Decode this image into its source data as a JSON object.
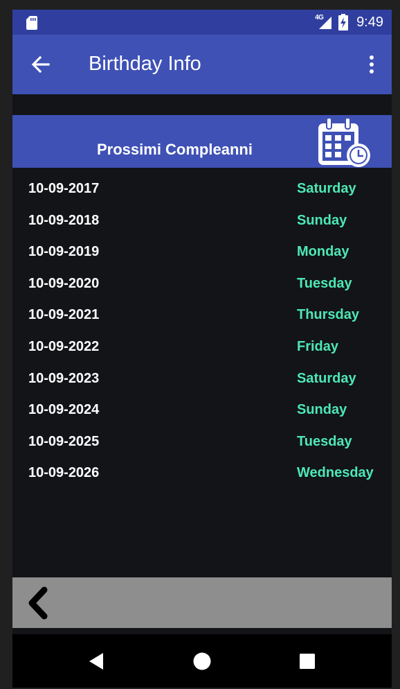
{
  "status_bar": {
    "network": "4G",
    "time": "9:49",
    "icons": [
      "sd-card-icon",
      "signal-icon",
      "battery-charging-icon"
    ]
  },
  "app_bar": {
    "title": "Birthday Info",
    "icons": [
      "back-arrow-icon",
      "more-vert-icon"
    ]
  },
  "header": {
    "title": "Prossimi Compleanni",
    "icon": "calendar-clock-icon"
  },
  "birthdays": [
    {
      "date": "10-09-2017",
      "day": "Saturday"
    },
    {
      "date": "10-09-2018",
      "day": "Sunday"
    },
    {
      "date": "10-09-2019",
      "day": "Monday"
    },
    {
      "date": "10-09-2020",
      "day": "Tuesday"
    },
    {
      "date": "10-09-2021",
      "day": "Thursday"
    },
    {
      "date": "10-09-2022",
      "day": "Friday"
    },
    {
      "date": "10-09-2023",
      "day": "Saturday"
    },
    {
      "date": "10-09-2024",
      "day": "Sunday"
    },
    {
      "date": "10-09-2025",
      "day": "Tuesday"
    },
    {
      "date": "10-09-2026",
      "day": "Wednesday"
    }
  ],
  "bottom_bar": {
    "icon": "chevron-left-icon"
  },
  "nav_bar": {
    "icons": [
      "nav-back-icon",
      "nav-home-icon",
      "nav-recents-icon"
    ]
  },
  "colors": {
    "primary": "#3f51b5",
    "primary_dark": "#303f9f",
    "day_accent": "#4de8b4",
    "background": "#121418",
    "bottom_bar": "#8e8e8e"
  }
}
